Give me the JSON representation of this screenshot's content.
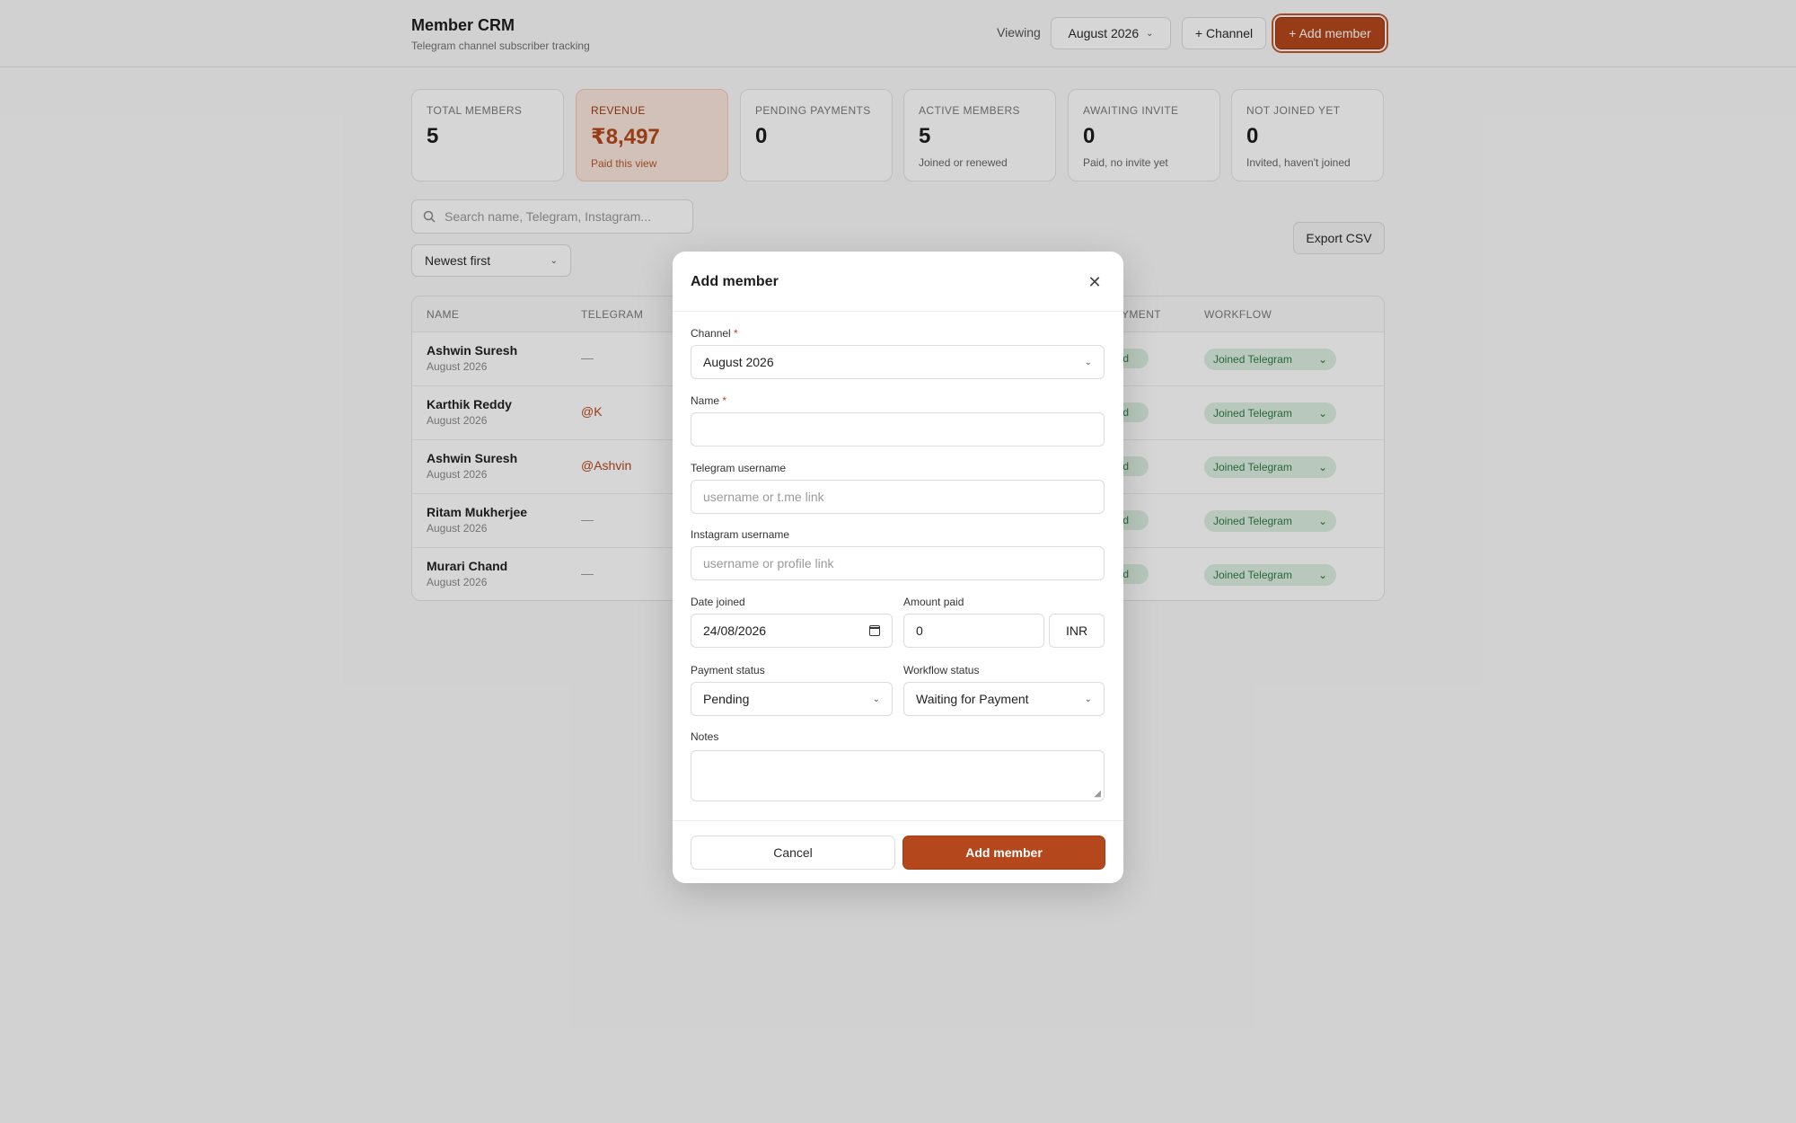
{
  "app": {
    "title": "Member CRM",
    "subtitle": "Telegram channel subscriber tracking",
    "viewing_label": "Viewing",
    "viewing_value": "August 2026",
    "channel_button": "+ Channel",
    "add_member_button": "+ Add member"
  },
  "stats": [
    {
      "label": "Total members",
      "value": "5",
      "sub": ""
    },
    {
      "label": "Revenue",
      "value": "₹8,497",
      "sub": "Paid this view"
    },
    {
      "label": "Pending payments",
      "value": "0",
      "sub": ""
    },
    {
      "label": "Active members",
      "value": "5",
      "sub": "Joined or renewed"
    },
    {
      "label": "Awaiting invite",
      "value": "0",
      "sub": "Paid, no invite yet"
    },
    {
      "label": "Not joined yet",
      "value": "0",
      "sub": "Invited, haven't joined"
    }
  ],
  "search": {
    "placeholder": "Search name, Telegram, Instagram..."
  },
  "sort": {
    "value": "Newest first"
  },
  "export_button": "Export CSV",
  "table": {
    "headers": {
      "name": "Name",
      "telegram": "Telegram",
      "payment": "yment",
      "workflow": "Workflow"
    },
    "rows": [
      {
        "name": "Ashwin Suresh",
        "channel": "August 2026",
        "telegram": "—",
        "payment": "aid",
        "workflow": "Joined Telegram"
      },
      {
        "name": "Karthik Reddy",
        "channel": "August 2026",
        "telegram": "@K",
        "payment": "aid",
        "workflow": "Joined Telegram"
      },
      {
        "name": "Ashwin Suresh",
        "channel": "August 2026",
        "telegram": "@Ashvin",
        "payment": "aid",
        "workflow": "Joined Telegram"
      },
      {
        "name": "Ritam Mukherjee",
        "channel": "August 2026",
        "telegram": "—",
        "payment": "aid",
        "workflow": "Joined Telegram"
      },
      {
        "name": "Murari Chand",
        "channel": "August 2026",
        "telegram": "—",
        "payment": "aid",
        "workflow": "Joined Telegram"
      }
    ]
  },
  "modal": {
    "title": "Add member",
    "channel": {
      "label": "Channel",
      "value": "August 2026"
    },
    "name": {
      "label": "Name",
      "value": ""
    },
    "telegram": {
      "label": "Telegram username",
      "placeholder": "username or t.me link"
    },
    "instagram": {
      "label": "Instagram username",
      "placeholder": "username or profile link"
    },
    "date_joined": {
      "label": "Date joined",
      "value": "24/08/2026"
    },
    "amount_paid": {
      "label": "Amount paid",
      "value": "0",
      "currency": "INR"
    },
    "payment_status": {
      "label": "Payment status",
      "value": "Pending"
    },
    "workflow_status": {
      "label": "Workflow status",
      "value": "Waiting for Payment"
    },
    "notes": {
      "label": "Notes",
      "value": ""
    },
    "cancel_button": "Cancel",
    "submit_button": "Add member",
    "required_mark": "*"
  },
  "colors": {
    "accent": "#b4481c",
    "success_bg": "#dcefe0",
    "success_text": "#2f7a45"
  }
}
